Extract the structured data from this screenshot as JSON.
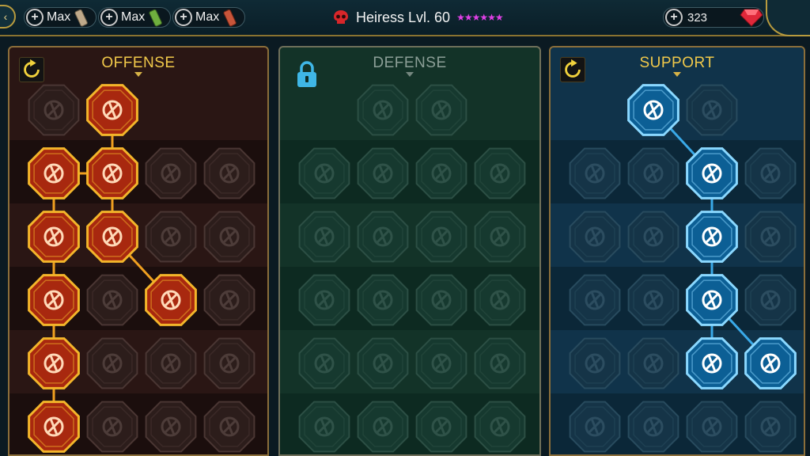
{
  "topbar": {
    "resources": [
      {
        "label": "Max",
        "icon": "silver-scroll-icon",
        "color": "#bfa98a"
      },
      {
        "label": "Max",
        "icon": "green-scroll-icon",
        "color": "#6fae3e"
      },
      {
        "label": "Max",
        "icon": "red-scroll-icon",
        "color": "#c8553a"
      }
    ],
    "hero_name": "Heiress Lvl. 60",
    "stars": "★★★★★★",
    "gems": "323"
  },
  "colors": {
    "offense_active": "#f0a020",
    "support_active": "#39a9e8",
    "gold": "#f1c94a"
  },
  "panels": {
    "offense": {
      "title": "OFFENSE",
      "nodes": [
        {
          "row": 0,
          "col": 0,
          "icon": "crossed-swords-icon",
          "active": false
        },
        {
          "row": 0,
          "col": 1,
          "icon": "blade-slash-icon",
          "active": true
        },
        {
          "row": 1,
          "col": 0,
          "icon": "horned-demon-icon",
          "active": true
        },
        {
          "row": 1,
          "col": 1,
          "icon": "triple-sword-icon",
          "active": true
        },
        {
          "row": 1,
          "col": 2,
          "icon": "shield-arrow-icon",
          "active": false
        },
        {
          "row": 1,
          "col": 3,
          "icon": "heart-crown-icon",
          "active": false
        },
        {
          "row": 2,
          "col": 0,
          "icon": "archer-icon",
          "active": true
        },
        {
          "row": 2,
          "col": 1,
          "icon": "fanged-mouth-icon",
          "active": true
        },
        {
          "row": 2,
          "col": 2,
          "icon": "skull-cloak-icon",
          "active": false
        },
        {
          "row": 2,
          "col": 3,
          "icon": "grabbing-hand-icon",
          "active": false
        },
        {
          "row": 3,
          "col": 0,
          "icon": "pierced-heart-icon",
          "active": true
        },
        {
          "row": 3,
          "col": 1,
          "icon": "fist-strike-icon",
          "active": false
        },
        {
          "row": 3,
          "col": 2,
          "icon": "axe-icon",
          "active": true
        },
        {
          "row": 3,
          "col": 3,
          "icon": "lightning-chain-icon",
          "active": false
        },
        {
          "row": 4,
          "col": 0,
          "icon": "arrow-impact-icon",
          "active": true
        },
        {
          "row": 4,
          "col": 1,
          "icon": "skulls-icon",
          "active": false
        },
        {
          "row": 4,
          "col": 2,
          "icon": "sword-shield-icon",
          "active": false
        },
        {
          "row": 4,
          "col": 3,
          "icon": "warrior-icon",
          "active": false
        },
        {
          "row": 5,
          "col": 0,
          "icon": "sword-sparkle-icon",
          "active": true
        },
        {
          "row": 5,
          "col": 1,
          "icon": "knight-helm-icon",
          "active": false
        },
        {
          "row": 5,
          "col": 2,
          "icon": "demon-icon",
          "active": false
        },
        {
          "row": 5,
          "col": 3,
          "icon": "spartan-skull-icon",
          "active": false
        }
      ]
    },
    "defense": {
      "title": "DEFENSE",
      "nodes": [
        {
          "row": 0,
          "col": 1,
          "icon": "brick-wall-icon",
          "active": false
        },
        {
          "row": 0,
          "col": 2,
          "icon": "raised-fist-icon",
          "active": false
        },
        {
          "row": 1,
          "col": 0,
          "icon": "cloak-icon",
          "active": false
        },
        {
          "row": 1,
          "col": 1,
          "icon": "bleeding-heart-icon",
          "active": false
        },
        {
          "row": 1,
          "col": 2,
          "icon": "armored-body-icon",
          "active": false
        },
        {
          "row": 1,
          "col": 3,
          "icon": "broken-sword-icon",
          "active": false
        },
        {
          "row": 2,
          "col": 0,
          "icon": "mage-icon",
          "active": false
        },
        {
          "row": 2,
          "col": 1,
          "icon": "knight-shield-icon",
          "active": false
        },
        {
          "row": 2,
          "col": 2,
          "icon": "heart-shield-icon",
          "active": false
        },
        {
          "row": 2,
          "col": 3,
          "icon": "monk-icon",
          "active": false
        },
        {
          "row": 3,
          "col": 0,
          "icon": "figures-icon",
          "active": false
        },
        {
          "row": 3,
          "col": 1,
          "icon": "hourglass-icon",
          "active": false
        },
        {
          "row": 3,
          "col": 2,
          "icon": "magic-hand-icon",
          "active": false
        },
        {
          "row": 3,
          "col": 3,
          "icon": "bull-icon",
          "active": false
        },
        {
          "row": 4,
          "col": 0,
          "icon": "runner-icon",
          "active": false
        },
        {
          "row": 4,
          "col": 1,
          "icon": "drops-icon",
          "active": false
        },
        {
          "row": 4,
          "col": 2,
          "icon": "skull-burst-icon",
          "active": false
        },
        {
          "row": 4,
          "col": 3,
          "icon": "no-shield-icon",
          "active": false
        },
        {
          "row": 5,
          "col": 0,
          "icon": "fire-body-icon",
          "active": false
        },
        {
          "row": 5,
          "col": 1,
          "icon": "swirl-shield-icon",
          "active": false
        },
        {
          "row": 5,
          "col": 2,
          "icon": "skeleton-icon",
          "active": false
        },
        {
          "row": 5,
          "col": 3,
          "icon": "titan-icon",
          "active": false
        }
      ]
    },
    "support": {
      "title": "SUPPORT",
      "nodes": [
        {
          "row": 0,
          "col": 1,
          "icon": "heart-plus-icon",
          "active": true
        },
        {
          "row": 0,
          "col": 2,
          "icon": "fist-aura-icon",
          "active": false
        },
        {
          "row": 1,
          "col": 0,
          "icon": "praying-hands-icon",
          "active": false
        },
        {
          "row": 1,
          "col": 1,
          "icon": "ring-shield-icon",
          "active": false
        },
        {
          "row": 1,
          "col": 2,
          "icon": "flaming-skull-icon",
          "active": true
        },
        {
          "row": 1,
          "col": 3,
          "icon": "wind-arrow-icon",
          "active": false
        },
        {
          "row": 2,
          "col": 0,
          "icon": "healer-icon",
          "active": false
        },
        {
          "row": 2,
          "col": 1,
          "icon": "lightning-shield-icon",
          "active": false
        },
        {
          "row": 2,
          "col": 2,
          "icon": "lightning-burst-icon",
          "active": true
        },
        {
          "row": 2,
          "col": 3,
          "icon": "twin-figures-icon",
          "active": false
        },
        {
          "row": 3,
          "col": 0,
          "icon": "heart-chain-icon",
          "active": false
        },
        {
          "row": 3,
          "col": 1,
          "icon": "meteor-icon",
          "active": false
        },
        {
          "row": 3,
          "col": 2,
          "icon": "open-book-icon",
          "active": true
        },
        {
          "row": 3,
          "col": 3,
          "icon": "rage-face-icon",
          "active": false
        },
        {
          "row": 4,
          "col": 0,
          "icon": "compass-star-icon",
          "active": false
        },
        {
          "row": 4,
          "col": 1,
          "icon": "boot-icon",
          "active": false
        },
        {
          "row": 4,
          "col": 2,
          "icon": "all-seeing-eye-icon",
          "active": true
        },
        {
          "row": 4,
          "col": 3,
          "icon": "dancer-icon",
          "active": true
        },
        {
          "row": 5,
          "col": 0,
          "icon": "potion-icon",
          "active": false
        },
        {
          "row": 5,
          "col": 1,
          "icon": "skull-icon",
          "active": false
        },
        {
          "row": 5,
          "col": 2,
          "icon": "grab-hand-icon",
          "active": false
        },
        {
          "row": 5,
          "col": 3,
          "icon": "eagle-icon",
          "active": false
        }
      ]
    }
  }
}
